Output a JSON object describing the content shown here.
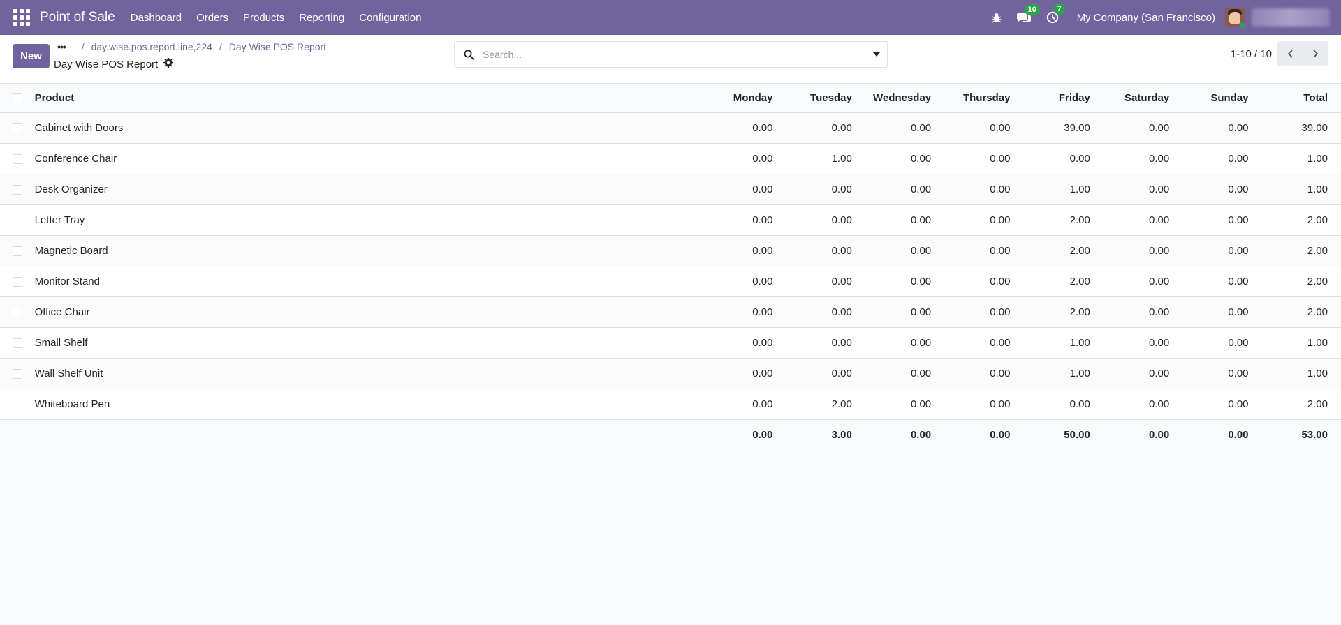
{
  "navbar": {
    "brand": "Point of Sale",
    "menu": [
      "Dashboard",
      "Orders",
      "Products",
      "Reporting",
      "Configuration"
    ],
    "messages_badge": "10",
    "activities_badge": "7",
    "company": "My Company (San Francisco)"
  },
  "control_panel": {
    "new_label": "New",
    "breadcrumb": [
      "day.wise.pos.report.line,224",
      "Day Wise POS Report"
    ],
    "title": "Day Wise POS Report",
    "search_placeholder": "Search...",
    "pager_value": "1-10 / 10"
  },
  "table": {
    "columns": [
      "Product",
      "Monday",
      "Tuesday",
      "Wednesday",
      "Thursday",
      "Friday",
      "Saturday",
      "Sunday",
      "Total"
    ],
    "rows": [
      [
        "Cabinet with Doors",
        "0.00",
        "0.00",
        "0.00",
        "0.00",
        "39.00",
        "0.00",
        "0.00",
        "39.00"
      ],
      [
        "Conference Chair",
        "0.00",
        "1.00",
        "0.00",
        "0.00",
        "0.00",
        "0.00",
        "0.00",
        "1.00"
      ],
      [
        "Desk Organizer",
        "0.00",
        "0.00",
        "0.00",
        "0.00",
        "1.00",
        "0.00",
        "0.00",
        "1.00"
      ],
      [
        "Letter Tray",
        "0.00",
        "0.00",
        "0.00",
        "0.00",
        "2.00",
        "0.00",
        "0.00",
        "2.00"
      ],
      [
        "Magnetic Board",
        "0.00",
        "0.00",
        "0.00",
        "0.00",
        "2.00",
        "0.00",
        "0.00",
        "2.00"
      ],
      [
        "Monitor Stand",
        "0.00",
        "0.00",
        "0.00",
        "0.00",
        "2.00",
        "0.00",
        "0.00",
        "2.00"
      ],
      [
        "Office Chair",
        "0.00",
        "0.00",
        "0.00",
        "0.00",
        "2.00",
        "0.00",
        "0.00",
        "2.00"
      ],
      [
        "Small Shelf",
        "0.00",
        "0.00",
        "0.00",
        "0.00",
        "1.00",
        "0.00",
        "0.00",
        "1.00"
      ],
      [
        "Wall Shelf Unit",
        "0.00",
        "0.00",
        "0.00",
        "0.00",
        "1.00",
        "0.00",
        "0.00",
        "1.00"
      ],
      [
        "Whiteboard Pen",
        "0.00",
        "2.00",
        "0.00",
        "0.00",
        "0.00",
        "0.00",
        "0.00",
        "2.00"
      ]
    ],
    "totals": [
      "",
      "0.00",
      "3.00",
      "0.00",
      "0.00",
      "50.00",
      "0.00",
      "0.00",
      "53.00"
    ]
  },
  "colors": {
    "brand": "#71639e",
    "badge": "#28a745"
  }
}
